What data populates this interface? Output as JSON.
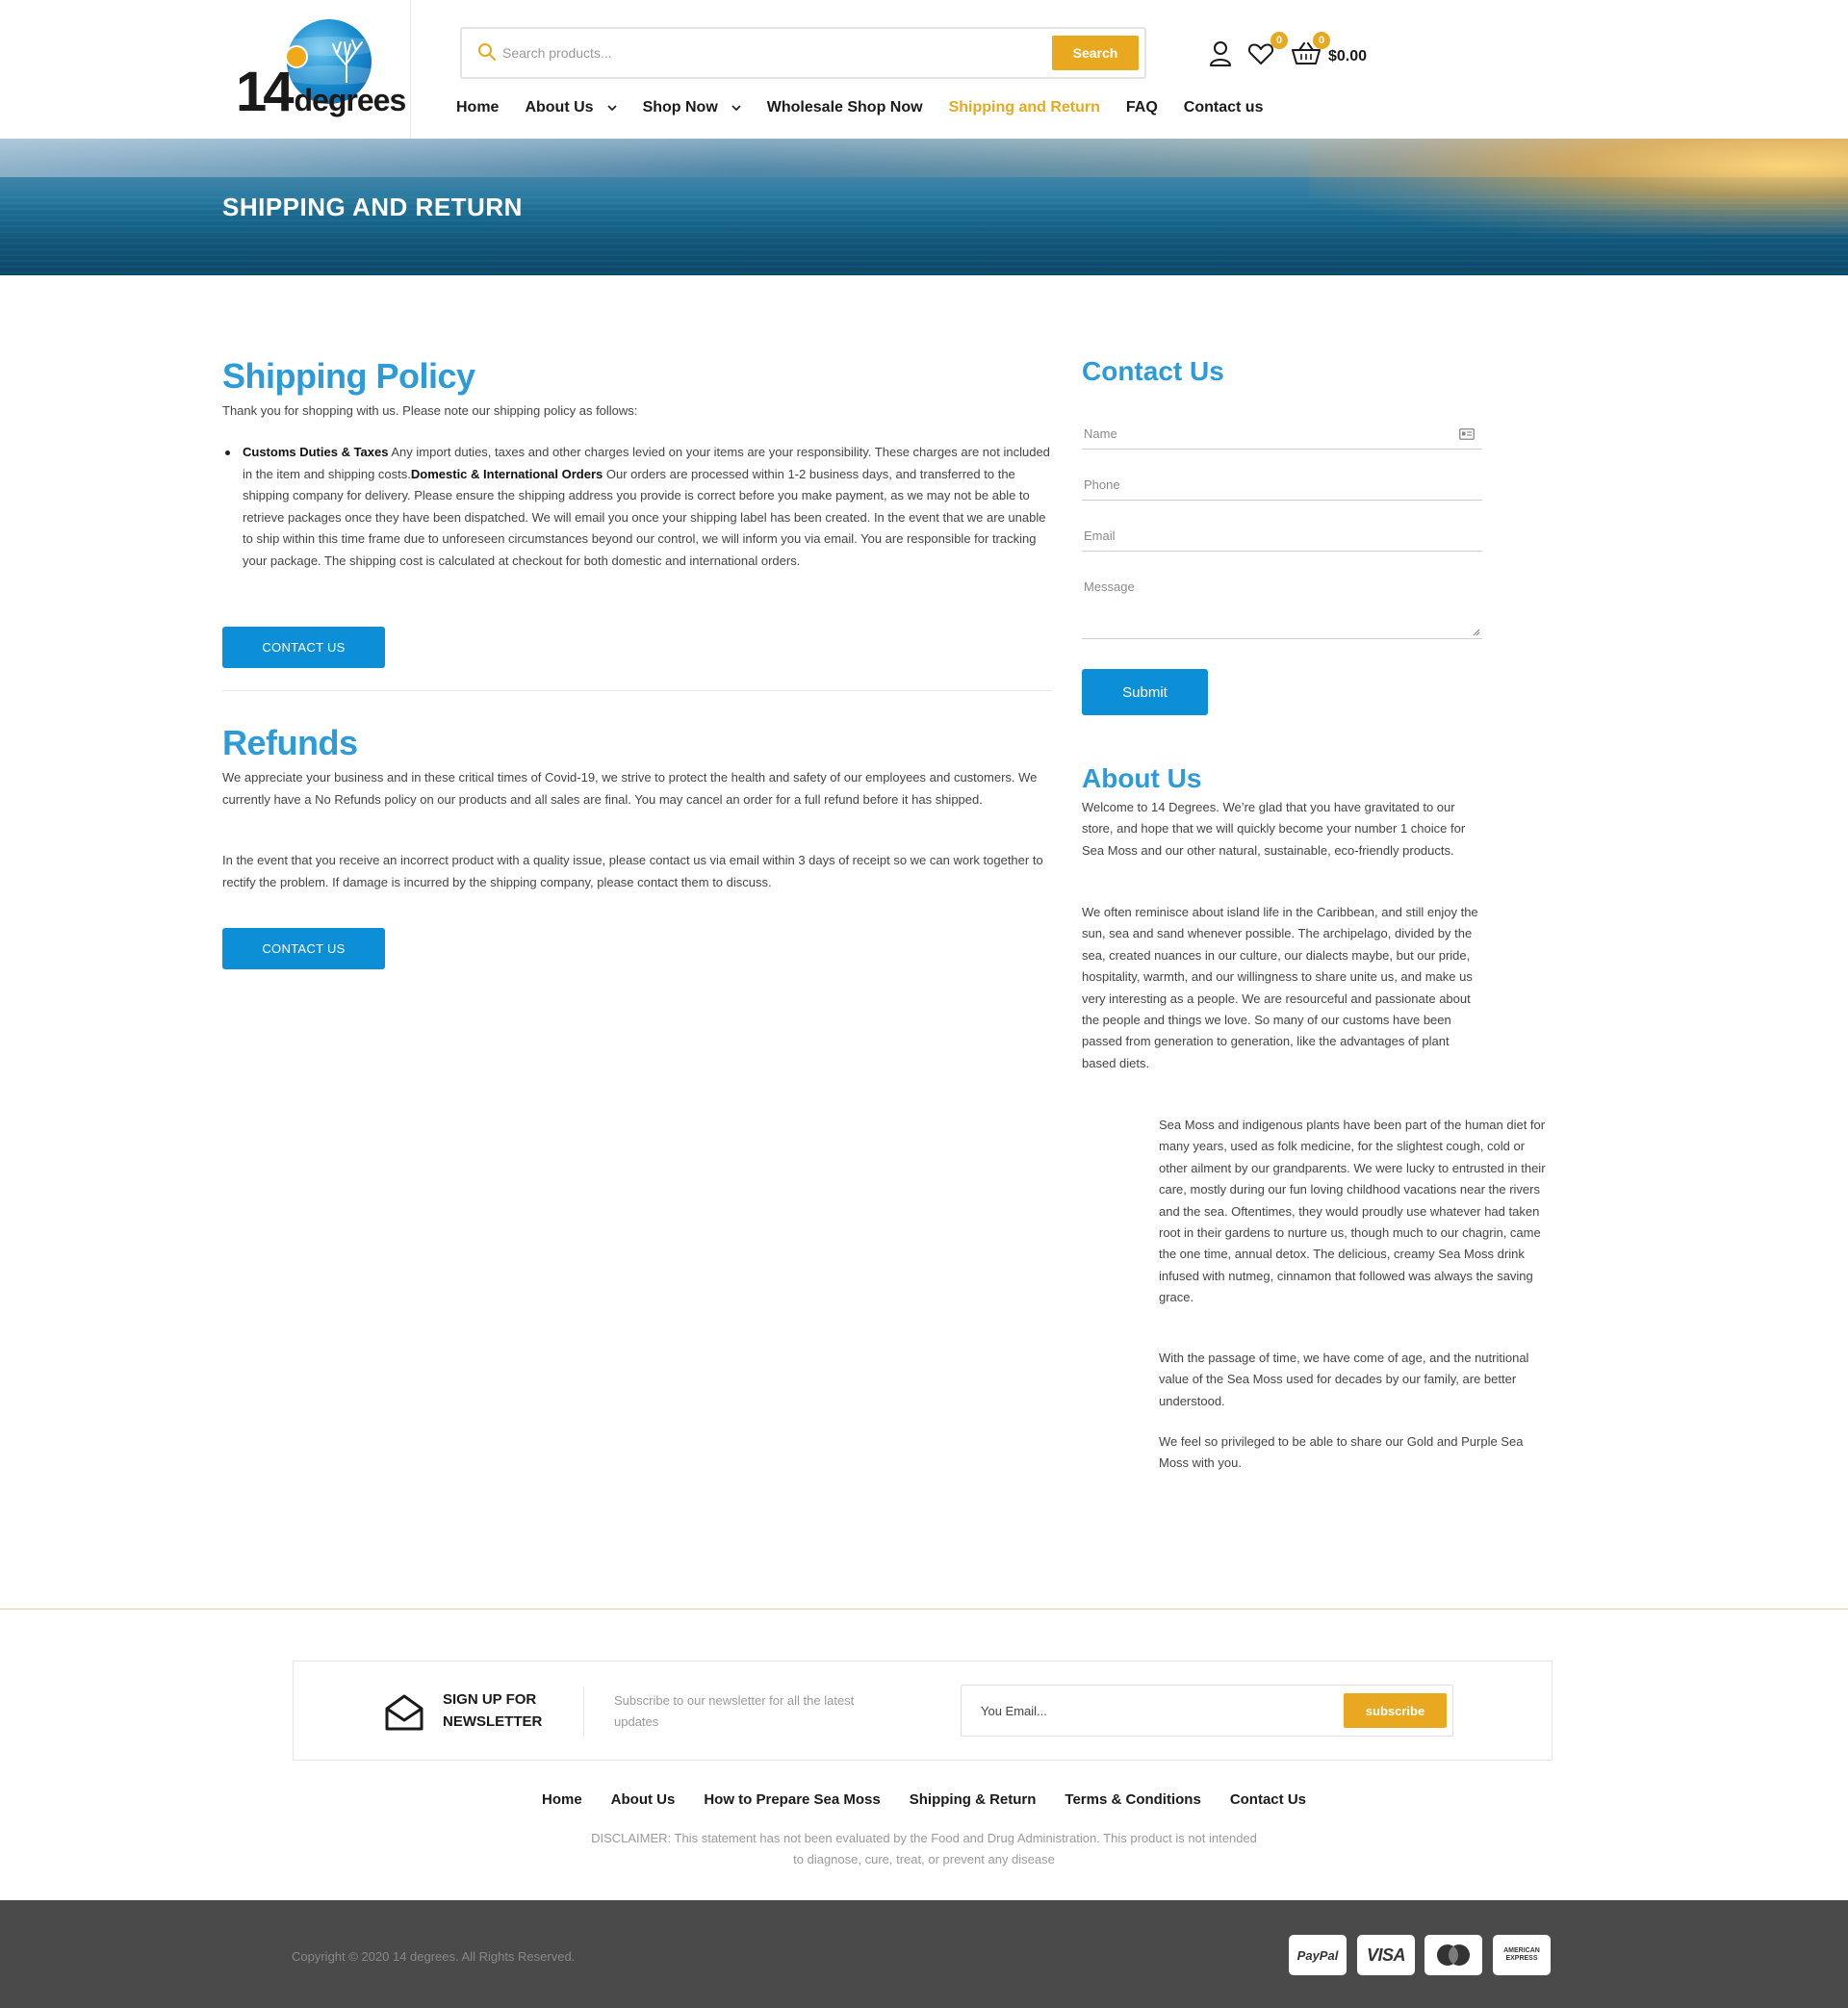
{
  "header": {
    "logo": {
      "number": "14",
      "word": "degrees"
    },
    "search": {
      "placeholder": "Search products...",
      "button_label": "Search"
    },
    "wishlist_count": "0",
    "cart_count": "0",
    "cart_total": "$0.00",
    "nav": [
      {
        "label": "Home"
      },
      {
        "label": "About Us",
        "has_dropdown": true
      },
      {
        "label": "Shop Now",
        "has_dropdown": true
      },
      {
        "label": "Wholesale Shop Now"
      },
      {
        "label": "Shipping and Return",
        "active": true
      },
      {
        "label": "FAQ"
      },
      {
        "label": "Contact us"
      }
    ]
  },
  "banner": {
    "title": "SHIPPING AND RETURN"
  },
  "shipping": {
    "title": "Shipping Policy",
    "intro": "Thank you for shopping with us. Please note our shipping policy as follows:",
    "customs_label": "Customs Duties & Taxes",
    "customs_text": " Any import duties, taxes and other charges levied on your items are your responsibility. These charges are not included in the item and shipping costs.",
    "orders_label": "Domestic & International Orders",
    "orders_text": " Our orders are processed within 1-2 business days, and transferred to the shipping company for delivery. Please ensure the shipping address you provide is correct before you make payment, as we may not be able to retrieve packages once they have been dispatched. We will email you once your shipping label has been created. In the event that we are unable to ship within this time frame due to unforeseen circumstances beyond our control, we will inform you via email. You are responsible for tracking your package. The shipping cost is calculated at checkout for both domestic and international orders.",
    "cta_label": "CONTACT US"
  },
  "refunds": {
    "title": "Refunds",
    "p1": "We appreciate your business and in these critical times of Covid-19, we strive to protect the health and safety of our employees and customers. We currently have a No Refunds policy on our products and all sales are final. You may cancel an order for a full refund before it has shipped.",
    "p2": "In the event that you receive an incorrect product with a quality issue, please contact us via email within 3 days of receipt so we can work together to rectify the problem. If damage is incurred by the shipping company, please contact them to discuss.",
    "cta_label": "CONTACT US"
  },
  "contact_form": {
    "title": "Contact Us",
    "name_placeholder": "Name",
    "phone_placeholder": "Phone",
    "email_placeholder": "Email",
    "message_placeholder": "Message",
    "submit_label": "Submit"
  },
  "about": {
    "title": "About Us",
    "p1": "Welcome to 14 Degrees. We’re glad that you have gravitated to our store, and hope that we will quickly become your number 1 choice for Sea Moss and our other natural, sustainable, eco-friendly products.",
    "p2": "We often reminisce about island life in the Caribbean, and still enjoy the sun, sea and sand whenever possible. The archipelago, divided by the sea, created nuances in our culture, our dialects maybe, but our pride, hospitality, warmth, and our willingness to share unite us, and make us very interesting as a people. We are resourceful and passionate about the people and things we love. So many of our customs have been passed from generation to generation, like the advantages of plant based diets.",
    "p3": "Sea Moss and indigenous plants have been part of the human diet for many years, used as folk medicine, for the slightest cough, cold or other ailment by our grandparents. We were lucky to entrusted in their care, mostly during our fun loving childhood vacations near the rivers and the sea. Oftentimes, they would proudly use whatever had taken root in their gardens to nurture us, though much to our chagrin, came the one time, annual detox. The delicious, creamy Sea Moss drink infused with nutmeg, cinnamon that followed was always the saving grace.",
    "p4": "With the passage of time, we have come of age, and the nutritional value of the Sea Moss used for decades by our family, are better understood.",
    "p5": "We feel so privileged to be able to share our Gold and Purple Sea Moss with you."
  },
  "newsletter": {
    "heading": "SIGN UP FOR NEWSLETTER",
    "description": "Subscribe to our newsletter for all the latest updates",
    "input_placeholder": "You Email...",
    "button_label": "subscribe"
  },
  "footer": {
    "nav": [
      {
        "label": "Home"
      },
      {
        "label": "About Us"
      },
      {
        "label": "How to Prepare Sea Moss"
      },
      {
        "label": "Shipping & Return"
      },
      {
        "label": "Terms & Conditions"
      },
      {
        "label": "Contact Us"
      }
    ],
    "disclaimer": "DISCLAIMER: This statement has not been evaluated by the Food and Drug Administration. This product is not intended to diagnose, cure, treat, or prevent any disease",
    "copyright": "Copyright © 2020 14 degrees. All Rights Reserved.",
    "payments": {
      "paypal": "PayPal",
      "visa": "VISA",
      "amex_line1": "AMERICAN",
      "amex_line2": "EXPRESS"
    }
  },
  "colors": {
    "accent": "#e8a81f",
    "primary_blue": "#0d8fd8",
    "heading_blue": "#2c9bd8",
    "footer_bg": "#4a4a4a"
  },
  "icons": [
    "search-icon",
    "user-icon",
    "heart-icon",
    "cart-icon",
    "chevron-down-icon",
    "id-card-icon",
    "envelope-open-icon",
    "mastercard-icon"
  ]
}
